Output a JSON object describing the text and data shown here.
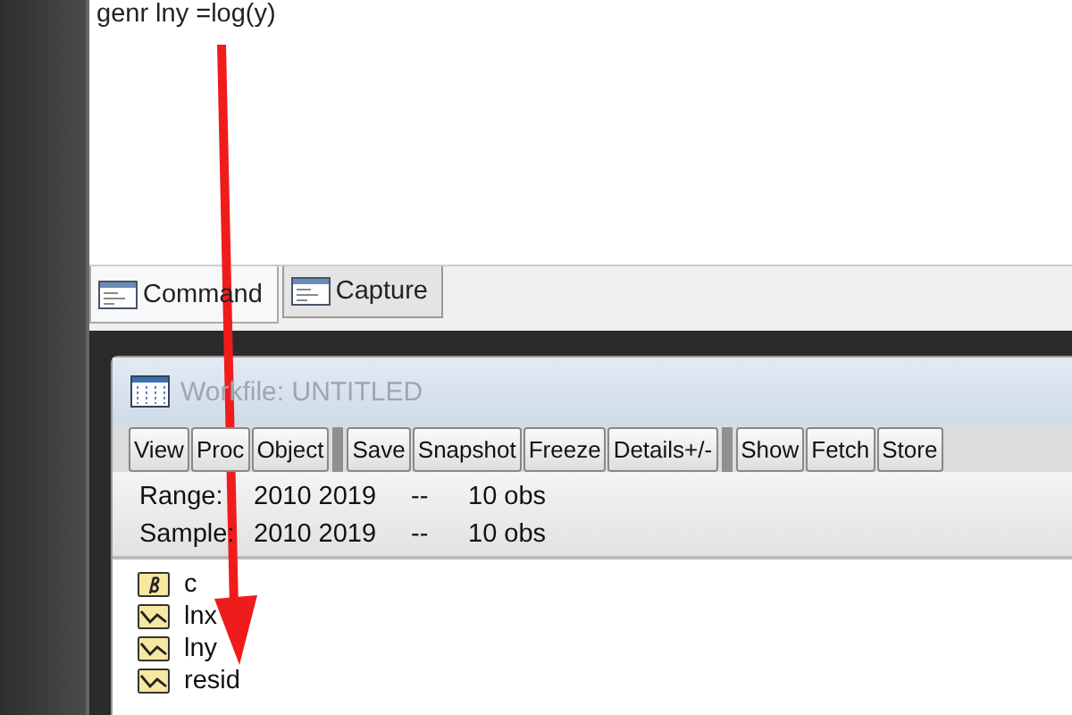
{
  "command_window": {
    "lines": [
      "genr lny =log(y)"
    ]
  },
  "tabs": [
    {
      "label": "Command",
      "selected": true
    },
    {
      "label": "Capture",
      "selected": false
    }
  ],
  "workfile": {
    "title": "Workfile: UNTITLED",
    "toolbar": [
      [
        "View",
        "Proc",
        "Object"
      ],
      [
        "Save",
        "Snapshot",
        "Freeze",
        "Details+/-"
      ],
      [
        "Show",
        "Fetch",
        "Store"
      ]
    ],
    "info": [
      {
        "label": "Range:",
        "value": "2010 2019",
        "sep": "--",
        "count": "10 obs"
      },
      {
        "label": "Sample:",
        "value": "2010 2019",
        "sep": "--",
        "count": "10 obs"
      }
    ],
    "objects": [
      {
        "name": "c",
        "kind": "coef"
      },
      {
        "name": "lnx",
        "kind": "series"
      },
      {
        "name": "lny",
        "kind": "series"
      },
      {
        "name": "resid",
        "kind": "series"
      }
    ]
  }
}
